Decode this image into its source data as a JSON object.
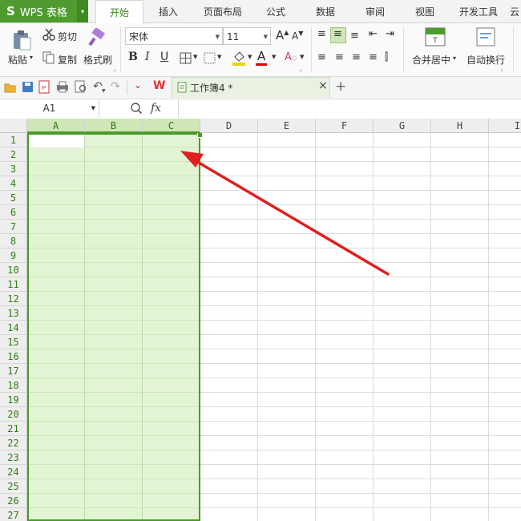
{
  "app": {
    "logo": "S",
    "name": "WPS 表格",
    "menu_arrow": "▾"
  },
  "tabs": [
    "开始",
    "插入",
    "页面布局",
    "公式",
    "数据",
    "审阅",
    "视图",
    "开发工具",
    "云"
  ],
  "active_tab": "开始",
  "ribbon": {
    "paste": "粘贴",
    "paste_arrow": "▾",
    "cut": "剪切",
    "copy": "复制",
    "format_painter": "格式刷",
    "font_name": "宋体",
    "font_size": "11",
    "bold": "B",
    "italic": "I",
    "underline": "U",
    "merge_center": "合并居中",
    "merge_arrow": "▾",
    "wrap_text": "自动换行"
  },
  "document_tab": {
    "title": "工作簿4 *",
    "close": "×",
    "new_tab": "+"
  },
  "formula_bar": {
    "cell_ref": "A1",
    "fx": "fx",
    "content": ""
  },
  "columns": [
    "A",
    "B",
    "C",
    "D",
    "E",
    "F",
    "G",
    "H",
    "I"
  ],
  "rows": [
    "1",
    "2",
    "3",
    "4",
    "5",
    "6",
    "7",
    "8",
    "9",
    "10",
    "11",
    "12",
    "13",
    "14",
    "15",
    "16",
    "17",
    "18",
    "19",
    "20",
    "21",
    "22",
    "23",
    "24",
    "25",
    "26",
    "27"
  ],
  "selected_columns": [
    "A",
    "B",
    "C"
  ],
  "colors": {
    "accent": "#4f9b2f",
    "selection": "#e3f4d4",
    "arrow": "#e02020"
  }
}
